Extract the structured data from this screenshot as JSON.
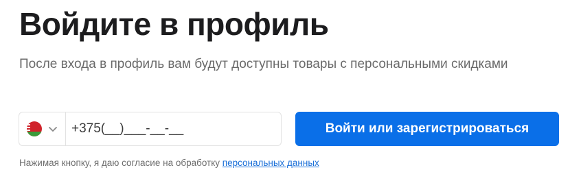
{
  "title": "Войдите в профиль",
  "subtitle": "После входа в профиль вам будут доступны товары с персональными скидками",
  "phone": {
    "country_flag": "belarus-flag",
    "value": "+375(__)___-__-__"
  },
  "submit_label": "Войти или зарегистрироваться",
  "consent": {
    "text": "Нажимая кнопку, я даю согласие на обработку ",
    "link": "персональных данных"
  },
  "colors": {
    "accent": "#0a6fe8",
    "link": "#1a6fd8"
  }
}
